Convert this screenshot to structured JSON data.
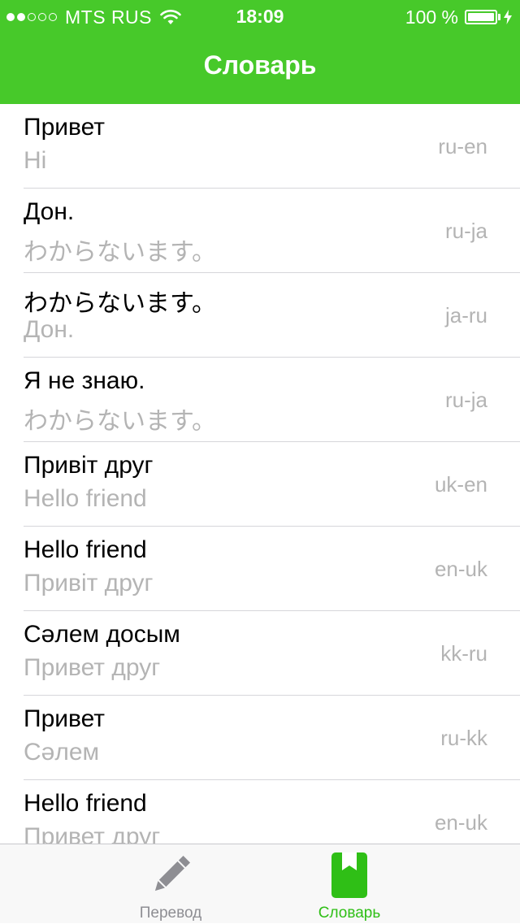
{
  "status_bar": {
    "carrier": "MTS RUS",
    "time": "18:09",
    "battery": "100 %",
    "battery_level": 1.0,
    "signal_strength": 2
  },
  "nav": {
    "title": "Словарь"
  },
  "entries": [
    {
      "source": "Привет",
      "target": "Hi",
      "lang": "ru-en"
    },
    {
      "source": "Дон.",
      "target": "わからないます。",
      "lang": "ru-ja"
    },
    {
      "source": "わからないます。",
      "target": "Дон.",
      "lang": "ja-ru"
    },
    {
      "source": "Я не знаю.",
      "target": "わからないます。",
      "lang": "ru-ja"
    },
    {
      "source": "Привіт друг",
      "target": "Hello friend",
      "lang": "uk-en"
    },
    {
      "source": "Hello friend",
      "target": "Привіт друг",
      "lang": "en-uk"
    },
    {
      "source": "Сәлем досым",
      "target": "Привет друг",
      "lang": "kk-ru"
    },
    {
      "source": "Привет",
      "target": "Сәлем",
      "lang": "ru-kk"
    },
    {
      "source": "Hello friend",
      "target": "Привет друг",
      "lang": "en-uk"
    }
  ],
  "tabbar": {
    "tabs": [
      {
        "label": "Перевод",
        "icon": "pencil-icon",
        "active": false
      },
      {
        "label": "Словарь",
        "icon": "bookmark-book-icon",
        "active": true
      }
    ]
  },
  "colors": {
    "accent": "#47c92a",
    "active_tab": "#2fbf16",
    "inactive_tab": "#8e8e93",
    "secondary_text": "#b4b4b4"
  }
}
